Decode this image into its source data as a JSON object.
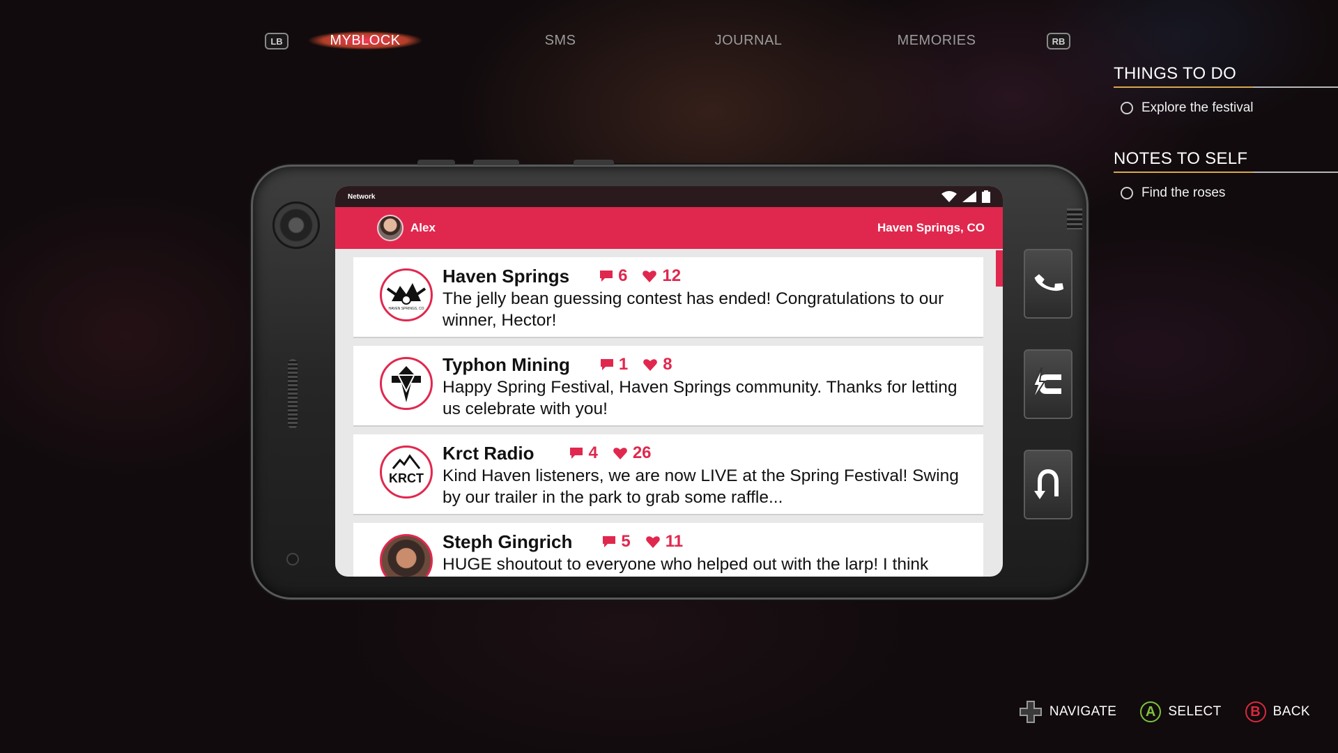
{
  "top_nav": {
    "left_bumper": "LB",
    "right_bumper": "RB",
    "tabs": [
      {
        "label": "MYBLOCK",
        "active": true
      },
      {
        "label": "SMS",
        "active": false
      },
      {
        "label": "JOURNAL",
        "active": false
      },
      {
        "label": "MEMORIES",
        "active": false
      }
    ]
  },
  "sidebar": {
    "things_to_do": {
      "title": "THINGS TO DO",
      "items": [
        "Explore the festival"
      ]
    },
    "notes_to_self": {
      "title": "NOTES TO SELF",
      "items": [
        "Find the roses"
      ]
    }
  },
  "phone": {
    "status_bar": {
      "network": "Network"
    },
    "header": {
      "user": "Alex",
      "location": "Haven Springs, CO"
    },
    "posts": [
      {
        "author": "Haven Springs",
        "comments": "6",
        "likes": "12",
        "text": "The jelly bean guessing contest has ended! Congratulations to our winner, Hector!",
        "logo_text": "HAVEN SPRINGS, CO"
      },
      {
        "author": "Typhon Mining",
        "comments": "1",
        "likes": "8",
        "text": "Happy Spring Festival, Haven Springs community. Thanks for letting us celebrate with you!",
        "logo_text": "T"
      },
      {
        "author": "Krct Radio",
        "comments": "4",
        "likes": "26",
        "text": "Kind Haven listeners, we are now LIVE at the Spring Festival! Swing by our trailer in the park to grab some raffle...",
        "logo_text": "KRCT"
      },
      {
        "author": "Steph Gingrich",
        "comments": "5",
        "likes": "11",
        "text": "HUGE shoutout to everyone who helped out with the larp! I think",
        "logo_text": ""
      }
    ],
    "side_buttons": [
      "phone-icon",
      "disconnect-icon",
      "back-arrow-icon"
    ]
  },
  "controls": {
    "navigate": "NAVIGATE",
    "select": {
      "button": "A",
      "label": "SELECT"
    },
    "back": {
      "button": "B",
      "label": "BACK"
    }
  },
  "colors": {
    "accent": "#e0284e",
    "select_button": "#7ec23c",
    "back_button": "#d9283d",
    "underline": "#d9a84a"
  }
}
